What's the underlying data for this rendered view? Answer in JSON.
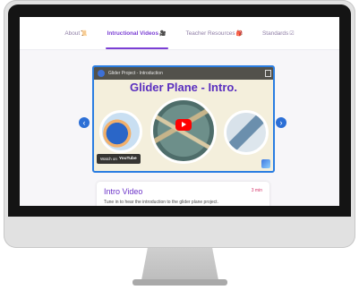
{
  "nav": {
    "tabs": [
      {
        "label": "About",
        "emoji": "📜",
        "active": false
      },
      {
        "label": "Intructional Videos",
        "emoji": "🎥",
        "active": true
      },
      {
        "label": "Teacher Resources",
        "emoji": "🎒",
        "active": false
      },
      {
        "label": "Standards",
        "emoji": "☑",
        "active": false
      }
    ]
  },
  "carousel": {
    "prev_icon": "‹",
    "next_icon": "›"
  },
  "video": {
    "channel_title": "Glider Project - Introduction",
    "title": "Glider Plane - Intro.",
    "watch_on": "Watch on",
    "platform": "YouTube"
  },
  "card": {
    "title": "Intro Video",
    "duration": "3 min",
    "description": "Tune in to hear the introduction to the glider plane project."
  },
  "colors": {
    "accent": "#7b3fd4",
    "arrow": "#2c6fd6",
    "play": "#ff0000"
  }
}
